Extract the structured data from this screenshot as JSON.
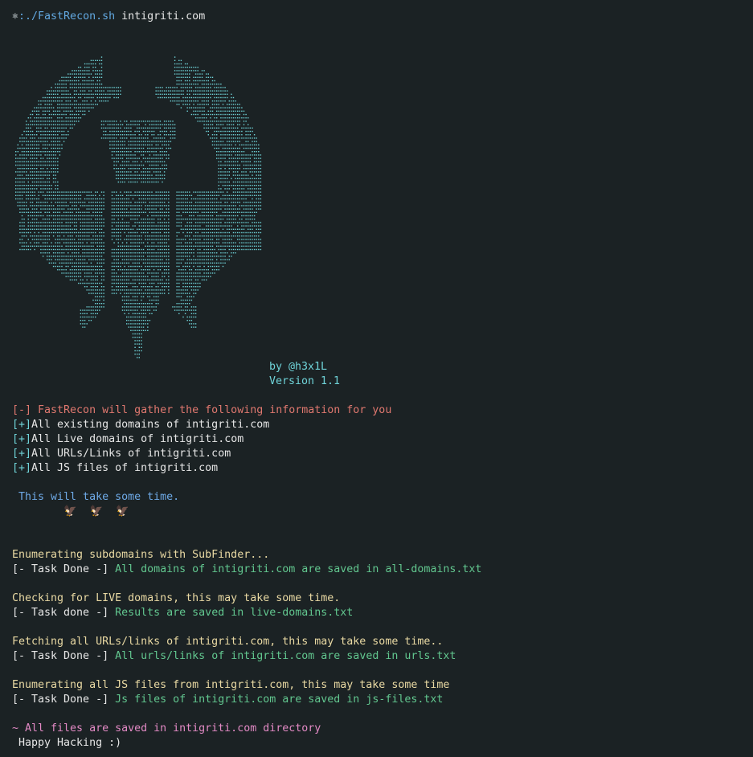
{
  "prompt": {
    "icon": "⎈",
    "path": ":./FastRecon.sh",
    "arg": "intigriti.com"
  },
  "banner": {
    "art_name": "eagle-dot-matrix-ascii-art",
    "color": "#6fd3d8"
  },
  "credit": {
    "author": "by @h3x1L",
    "version": "Version 1.1"
  },
  "intro": {
    "header": "[-] FastRecon will gather the following information for you",
    "items": [
      {
        "bullet": "[+]",
        "text": "All existing domains of intigriti.com"
      },
      {
        "bullet": "[+]",
        "text": "All Live domains of intigriti.com"
      },
      {
        "bullet": "[+]",
        "text": "All URLs/Links of intigriti.com"
      },
      {
        "bullet": "[+]",
        "text": "All JS files of intigriti.com"
      }
    ]
  },
  "notice": {
    "text": " This will take some time.",
    "emojis": "🦅 🦅 🦅"
  },
  "tasks": [
    {
      "status": "Enumerating subdomains with SubFinder...",
      "done_tag": "[- Task Done -]",
      "result": "All domains of intigriti.com are saved in all-domains.txt"
    },
    {
      "status": "Checking for LIVE domains, this may take some time.",
      "done_tag": "[- Task done -]",
      "result": "Results are saved in live-domains.txt"
    },
    {
      "status": "Fetching all URLs/links of intigriti.com, this may take some time..",
      "done_tag": "[- Task Done -]",
      "result": "All urls/links of intigriti.com are saved in urls.txt"
    },
    {
      "status": "Enumerating all JS files from intigriti.com, this may take some time",
      "done_tag": "[- Task Done -]",
      "result": "Js files of intigriti.com are saved in js-files.txt"
    }
  ],
  "footer": {
    "saved": "~ All files are saved in intigriti.com directory",
    "farewell": " Happy Hacking :)"
  },
  "colors": {
    "background": "#1b2224",
    "cyan": "#6fd3d8",
    "green": "#62c78f",
    "yellow": "#e9d9a3",
    "red": "#e0786f",
    "magenta": "#e38ac5",
    "blue": "#6ea9e6"
  }
}
